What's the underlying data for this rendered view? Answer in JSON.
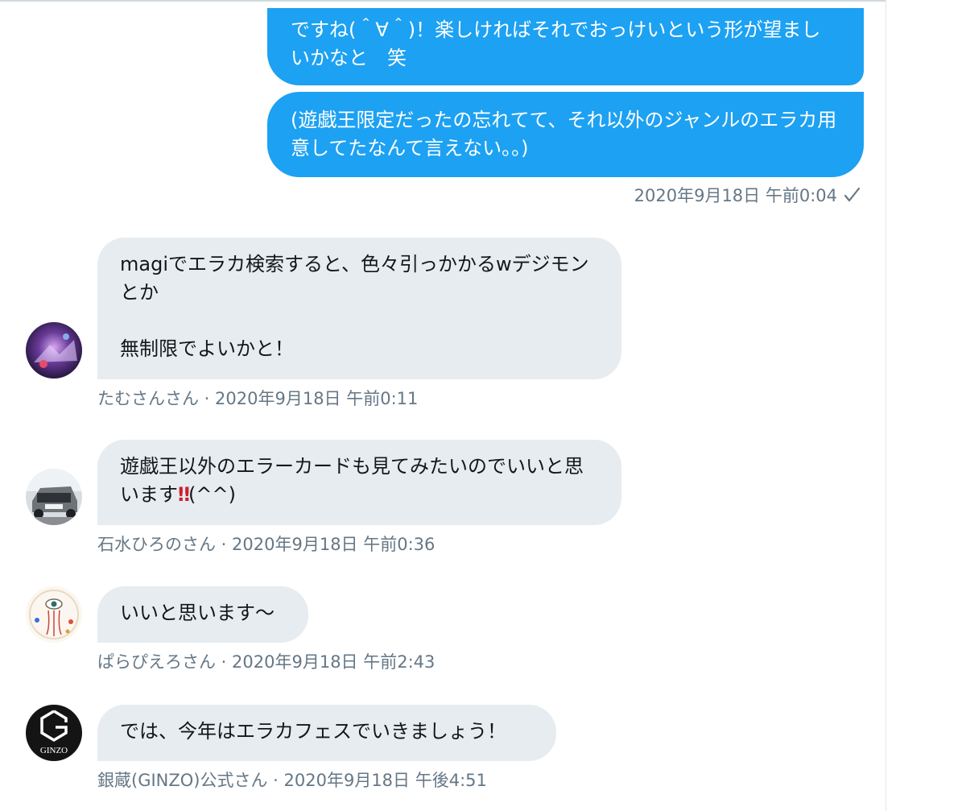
{
  "outgoing": {
    "messages": [
      {
        "text": "ですね(＾∀＾)！楽しければそれでおっけいという形が望ましいかなと　笑"
      },
      {
        "text": "(遊戯王限定だったの忘れてて、それ以外のジャンルのエラカ用意してたなんて言えない。。)"
      }
    ],
    "timestamp": "2020年9月18日 午前0:04",
    "status_icon": "checkmark-icon"
  },
  "incoming": [
    {
      "text": "magiでエラカ検索すると、色々引っかかるwデジモンとか\n\n無制限でよいかと！",
      "sender": "たむさんさん",
      "timestamp": "2020年9月18日 午前0:11",
      "avatar": "avatar-tamusan"
    },
    {
      "text_before": "遊戯王以外のエラーカードも見てみたいのでいいと思います",
      "emoji": "‼",
      "text_after": "(^^)",
      "sender": "石水ひろのさん",
      "timestamp": "2020年9月18日 午前0:36",
      "avatar": "avatar-ishimizu"
    },
    {
      "text": "いいと思います〜",
      "sender": "ぱらぴえろさん",
      "timestamp": "2020年9月18日 午前2:43",
      "avatar": "avatar-parapiero"
    },
    {
      "text": "では、今年はエラカフェスでいきましょう！",
      "sender": "銀蔵(GINZO)公式さん",
      "timestamp": "2020年9月18日 午後4:51",
      "avatar": "avatar-ginzo",
      "avatar_text": "GINZO"
    }
  ],
  "separator": " · ",
  "colors": {
    "outgoing_bubble": "#1da1f2",
    "incoming_bubble": "#e6ecf0",
    "meta_text": "#657786"
  }
}
